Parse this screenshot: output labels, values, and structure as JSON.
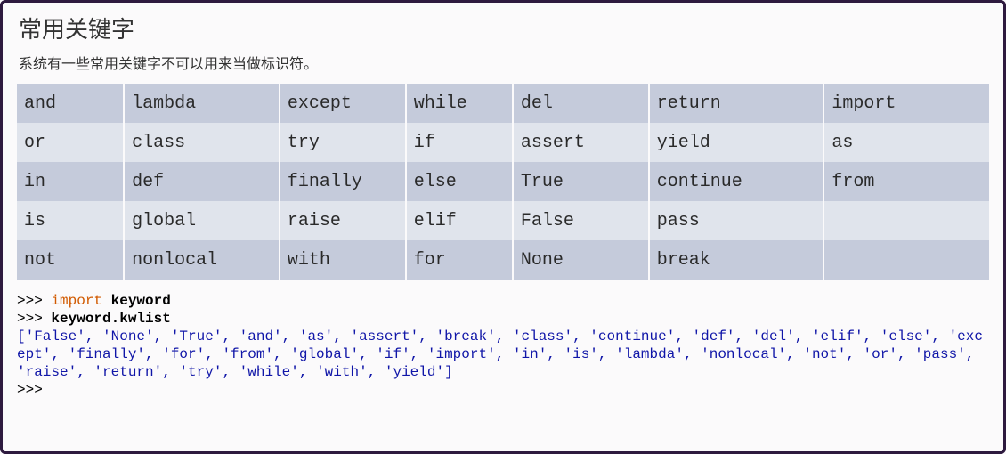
{
  "title": "常用关键字",
  "subtitle": "系统有一些常用关键字不可以用来当做标识符。",
  "table": {
    "rows": [
      [
        "and",
        "lambda",
        "except",
        "while",
        "del",
        "return",
        "import"
      ],
      [
        "or",
        "class",
        "try",
        "if",
        "assert",
        "yield",
        "as"
      ],
      [
        "in",
        "def",
        "finally",
        "else",
        "True",
        "continue",
        "from"
      ],
      [
        "is",
        "global",
        "raise",
        "elif",
        "False",
        "pass",
        ""
      ],
      [
        "not",
        "nonlocal",
        "with",
        "for",
        "None",
        "break",
        ""
      ]
    ]
  },
  "code": {
    "prompt": ">>> ",
    "line1_kw": "import",
    "line1_rest": " keyword",
    "line2": "keyword.kwlist",
    "output": "['False', 'None', 'True', 'and', 'as', 'assert', 'break', 'class', 'continue', 'def', 'del', 'elif', 'else', 'except', 'finally', 'for', 'from', 'global', 'if', 'import', 'in', 'is', 'lambda', 'nonlocal', 'not', 'or', 'pass', 'raise', 'return', 'try', 'while', 'with', 'yield']"
  }
}
